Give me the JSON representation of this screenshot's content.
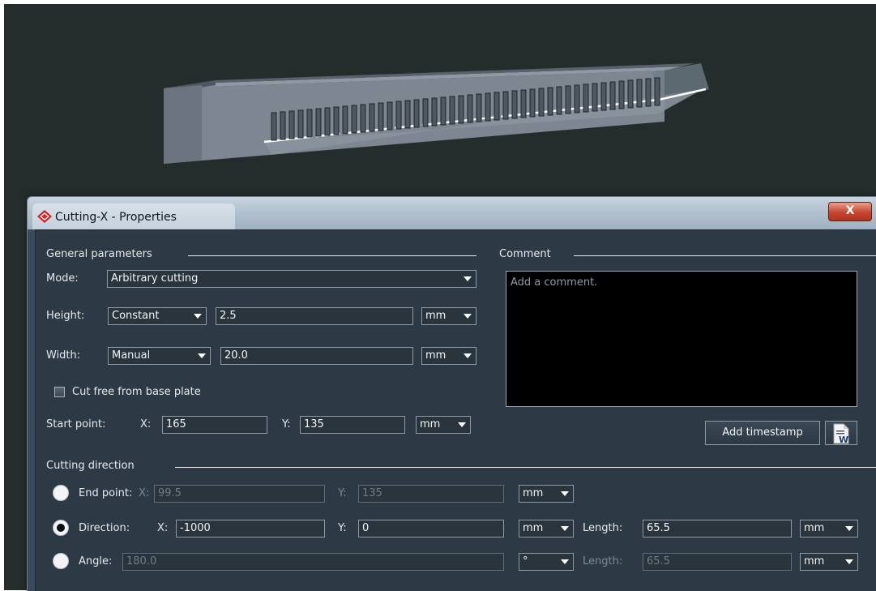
{
  "dialog": {
    "title": "Cutting-X - Properties",
    "close_label": "X"
  },
  "general": {
    "section_title": "General parameters",
    "mode_label": "Mode:",
    "mode_value": "Arbitrary cutting",
    "height_label": "Height:",
    "height_type": "Constant",
    "height_value": "2.5",
    "height_unit": "mm",
    "width_label": "Width:",
    "width_type": "Manual",
    "width_value": "20.0",
    "width_unit": "mm",
    "cut_free_label": "Cut free from base plate",
    "start_label": "Start point:",
    "start_x_label": "X:",
    "start_x": "165",
    "start_y_label": "Y:",
    "start_y": "135",
    "start_unit": "mm"
  },
  "comment": {
    "section_title": "Comment",
    "placeholder": "Add a comment.",
    "timestamp_button": "Add timestamp"
  },
  "direction": {
    "section_title": "Cutting direction",
    "end_point_label": "End point:",
    "end_x_label": "X:",
    "end_x": "99.5",
    "end_y_label": "Y:",
    "end_y": "135",
    "end_unit": "mm",
    "direction_label": "Direction:",
    "dir_x_label": "X:",
    "dir_x": "-1000",
    "dir_y_label": "Y:",
    "dir_y": "0",
    "dir_unit": "mm",
    "length_label": "Length:",
    "length_value": "65.5",
    "length_unit": "mm",
    "angle_label": "Angle:",
    "angle_value": "180.0",
    "angle_unit": "°",
    "angle_length_label": "Length:",
    "angle_length_value": "65.5",
    "angle_length_unit": "mm"
  },
  "colors": {
    "viewport_bg": "#252d2c",
    "panel_bg": "#2d3a45",
    "text": "#e6e9ec",
    "disabled_text": "#7d8a96"
  }
}
